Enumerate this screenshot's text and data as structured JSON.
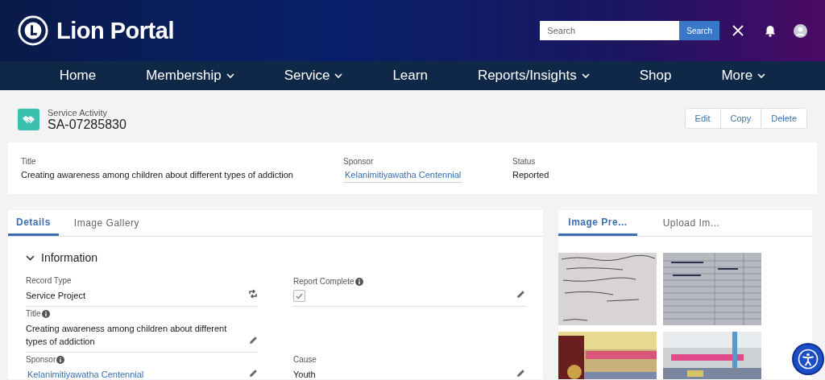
{
  "header": {
    "logo_text": "Lion Portal",
    "search": {
      "placeholder": "Search"
    },
    "search_button": "Search"
  },
  "nav": [
    {
      "label": "Home",
      "dropdown": false
    },
    {
      "label": "Membership",
      "dropdown": true
    },
    {
      "label": "Service",
      "dropdown": true
    },
    {
      "label": "Learn",
      "dropdown": false
    },
    {
      "label": "Reports/Insights",
      "dropdown": true
    },
    {
      "label": "Shop",
      "dropdown": false
    },
    {
      "label": "More",
      "dropdown": true
    }
  ],
  "record": {
    "object_type": "Service Activity",
    "record_number": "SA-07285830",
    "actions": [
      "Edit",
      "Copy",
      "Delete"
    ]
  },
  "highlights": [
    {
      "label": "Title",
      "value": "Creating awareness among children about different types of addiction",
      "kind": "text"
    },
    {
      "label": "Sponsor",
      "value": "Kelanimitiyawatha Centennial",
      "kind": "link"
    },
    {
      "label": "Status",
      "value": "Reported",
      "kind": "text"
    }
  ],
  "detail_tabs": [
    {
      "label": "Details",
      "selected": true
    },
    {
      "label": "Image Gallery",
      "selected": false
    }
  ],
  "section": {
    "title": "Information",
    "expanded": true
  },
  "field_rows": [
    {
      "left": {
        "label": "Record Type",
        "info": false,
        "kind": "record_type",
        "value": "Service Project",
        "editable": false
      },
      "right": {
        "label": "Report Complete",
        "info": true,
        "kind": "checkbox",
        "checked": true,
        "editable": true
      }
    },
    {
      "left": {
        "label": "Title",
        "info": true,
        "kind": "text",
        "value": "Creating awareness among children about different types of addiction",
        "editable": true
      }
    },
    {
      "left": {
        "label": "Sponsor",
        "info": true,
        "kind": "link",
        "value": "Kelanimitiyawatha Centennial",
        "editable": true
      },
      "right": {
        "label": "Cause",
        "info": false,
        "kind": "text",
        "value": "Youth",
        "editable": true
      }
    }
  ],
  "image_tabs": [
    {
      "label": "Image Pre...",
      "selected": true
    },
    {
      "label": "Upload Im...",
      "selected": false
    }
  ]
}
